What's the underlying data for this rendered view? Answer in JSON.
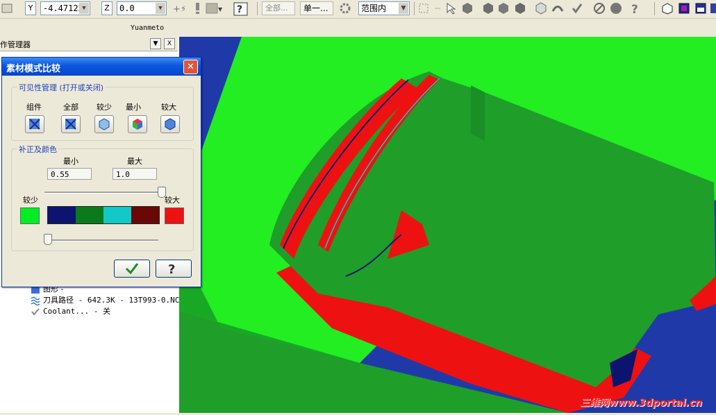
{
  "toolbar": {
    "y_axis_label": "Y",
    "y_value": "-4.47122",
    "z_axis_label": "Z",
    "z_value": "0.0",
    "filter_all": "全部...",
    "selection_single": "单一...",
    "range_inside": "范围内"
  },
  "window": {
    "title": "Yuanmeto"
  },
  "left_panel": {
    "title": "作管理器",
    "tree": [
      {
        "label": "图形 -"
      },
      {
        "label": "刀具路径 - 642.3K - 13T993-0.NC"
      },
      {
        "label": "Coolant... - 关"
      }
    ]
  },
  "dialog": {
    "title": "素材模式比较",
    "visibility_group": {
      "title": "可见性管理 (打开或关闭)",
      "buttons": [
        {
          "label": "组件",
          "icon": "component-visibility-icon"
        },
        {
          "label": "全部",
          "icon": "all-visibility-icon"
        },
        {
          "label": "较少",
          "icon": "less-visibility-icon"
        },
        {
          "label": "最小",
          "icon": "min-visibility-icon"
        },
        {
          "label": "较大",
          "icon": "more-visibility-icon"
        }
      ]
    },
    "tolerance_group": {
      "title": "补正及颜色",
      "min_label": "最小",
      "max_label": "最大",
      "min_value": "0.55",
      "max_value": "1.0",
      "less_label": "较少",
      "more_label": "较大",
      "less_color": "#00ee22",
      "more_color": "#ee1111",
      "color_bands": [
        "#0c1470",
        "#0a7a1a",
        "#12c8c8",
        "#6a0808"
      ],
      "upper_slider_level": 1.0,
      "lower_slider_level": 0.0
    },
    "ok_icon": "checkmark-icon",
    "help_icon": "question-mark-icon"
  },
  "viewport": {
    "watermark": "三维网www.3dportal.cn",
    "colors": {
      "stock": "#22ee22",
      "part": "#1f9e2a",
      "overcut": "#ee1111",
      "background": "#1f3aa8"
    }
  }
}
